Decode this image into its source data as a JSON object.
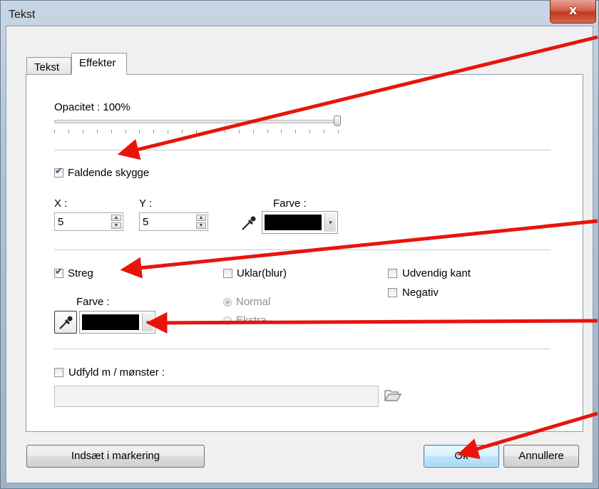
{
  "window": {
    "title": "Tekst",
    "close_glyph": "x"
  },
  "tabs": [
    {
      "label": "Tekst"
    },
    {
      "label": "Effekter"
    }
  ],
  "opacity": {
    "label": "Opacitet : 100%",
    "value_percent": 100
  },
  "drop_shadow": {
    "label": "Faldende skygge",
    "checked": true,
    "x_label": "X :",
    "x_value": "5",
    "y_label": "Y :",
    "y_value": "5",
    "color_label": "Farve :",
    "color": "#000000",
    "picker_icon": "eyedropper-icon"
  },
  "stroke": {
    "label": "Streg",
    "checked": true,
    "color_label": "Farve :",
    "color": "#000000",
    "picker_icon": "eyedropper-icon"
  },
  "blur": {
    "label": "Uklar(blur)",
    "checked": false,
    "options": [
      {
        "label": "Normal",
        "selected": true
      },
      {
        "label": "Ekstra",
        "selected": false
      }
    ]
  },
  "outer_edge": {
    "label": "Udvendig kant",
    "checked": false
  },
  "negative": {
    "label": "Negativ",
    "checked": false
  },
  "pattern_fill": {
    "label": "Udfyld m / mønster :",
    "checked": false,
    "path_value": "",
    "browse_icon": "folder-open-icon"
  },
  "buttons": {
    "insert_selection": "Indsæt i markering",
    "ok": "Ok",
    "cancel": "Annullere"
  },
  "annotation_arrow_color": "#e8140c"
}
